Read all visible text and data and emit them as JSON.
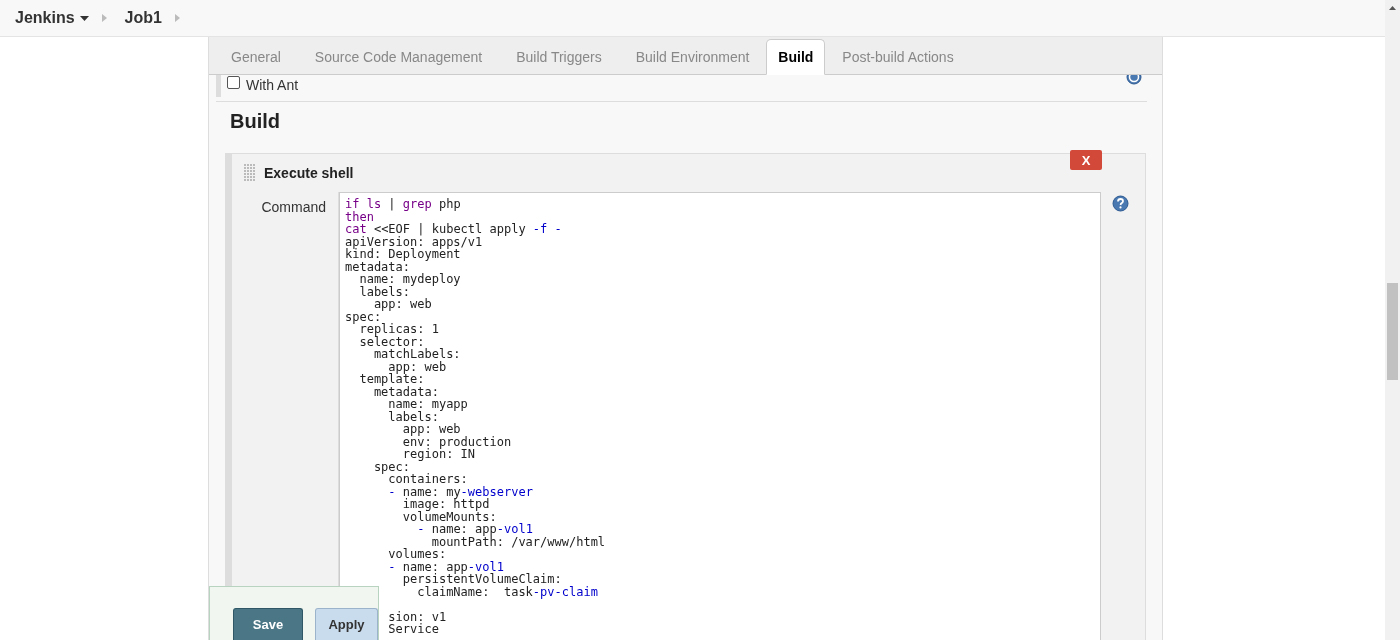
{
  "breadcrumb": [
    {
      "label": "Jenkins",
      "dropdown": true
    },
    {
      "label": "Job1",
      "dropdown": false
    }
  ],
  "tabs": [
    {
      "label": "General",
      "selected": false
    },
    {
      "label": "Source Code Management",
      "selected": false
    },
    {
      "label": "Build Triggers",
      "selected": false
    },
    {
      "label": "Build Environment",
      "selected": false
    },
    {
      "label": "Build",
      "selected": true
    },
    {
      "label": "Post-build Actions",
      "selected": false
    }
  ],
  "previous_option": {
    "label": "With Ant",
    "checked": false
  },
  "section_title": "Build",
  "build_step": {
    "title": "Execute shell",
    "delete_label": "X",
    "field_label": "Command",
    "lines": [
      {
        "tokens": [
          {
            "text": "if",
            "kind": "keyword"
          },
          {
            "text": " ls",
            "kind": "keyword"
          },
          {
            "text": " | ",
            "kind": "plain"
          },
          {
            "text": "grep",
            "kind": "keyword"
          },
          {
            "text": " php",
            "kind": "plain"
          }
        ]
      },
      {
        "tokens": [
          {
            "text": "then",
            "kind": "keyword"
          }
        ]
      },
      {
        "tokens": [
          {
            "text": "cat",
            "kind": "keyword"
          },
          {
            "text": " <<EOF | kubectl apply ",
            "kind": "plain"
          },
          {
            "text": "-f -",
            "kind": "operator"
          }
        ]
      },
      {
        "tokens": [
          {
            "text": "apiVersion: apps/v1",
            "kind": "plain"
          }
        ]
      },
      {
        "tokens": [
          {
            "text": "kind: Deployment",
            "kind": "plain"
          }
        ]
      },
      {
        "tokens": [
          {
            "text": "metadata:",
            "kind": "plain"
          }
        ]
      },
      {
        "tokens": [
          {
            "text": "  name: mydeploy",
            "kind": "plain"
          }
        ]
      },
      {
        "tokens": [
          {
            "text": "  labels:",
            "kind": "plain"
          }
        ]
      },
      {
        "tokens": [
          {
            "text": "    app: web",
            "kind": "plain"
          }
        ]
      },
      {
        "tokens": [
          {
            "text": "spec:",
            "kind": "plain"
          }
        ]
      },
      {
        "tokens": [
          {
            "text": "  replicas: 1",
            "kind": "plain"
          }
        ]
      },
      {
        "tokens": [
          {
            "text": "  selector:",
            "kind": "plain"
          }
        ]
      },
      {
        "tokens": [
          {
            "text": "    matchLabels:",
            "kind": "plain"
          }
        ]
      },
      {
        "tokens": [
          {
            "text": "      app: web",
            "kind": "plain"
          }
        ]
      },
      {
        "tokens": [
          {
            "text": "  template:",
            "kind": "plain"
          }
        ]
      },
      {
        "tokens": [
          {
            "text": "    metadata:",
            "kind": "plain"
          }
        ]
      },
      {
        "tokens": [
          {
            "text": "      name: myapp",
            "kind": "plain"
          }
        ]
      },
      {
        "tokens": [
          {
            "text": "      labels:",
            "kind": "plain"
          }
        ]
      },
      {
        "tokens": [
          {
            "text": "        app: web",
            "kind": "plain"
          }
        ]
      },
      {
        "tokens": [
          {
            "text": "        env: production",
            "kind": "plain"
          }
        ]
      },
      {
        "tokens": [
          {
            "text": "        region: IN",
            "kind": "plain"
          }
        ]
      },
      {
        "tokens": [
          {
            "text": "    spec:",
            "kind": "plain"
          }
        ]
      },
      {
        "tokens": [
          {
            "text": "      containers:",
            "kind": "plain"
          }
        ]
      },
      {
        "tokens": [
          {
            "text": "      -",
            "kind": "operator"
          },
          {
            "text": " name: my",
            "kind": "plain"
          },
          {
            "text": "-webserver",
            "kind": "operator"
          }
        ]
      },
      {
        "tokens": [
          {
            "text": "        image: httpd",
            "kind": "plain"
          }
        ]
      },
      {
        "tokens": [
          {
            "text": "        volumeMounts:",
            "kind": "plain"
          }
        ]
      },
      {
        "tokens": [
          {
            "text": "          -",
            "kind": "operator"
          },
          {
            "text": " name: app",
            "kind": "plain"
          },
          {
            "text": "-vol1",
            "kind": "operator"
          }
        ]
      },
      {
        "tokens": [
          {
            "text": "            mountPath: /var/www/html",
            "kind": "plain"
          }
        ]
      },
      {
        "tokens": [
          {
            "text": "      volumes:",
            "kind": "plain"
          }
        ]
      },
      {
        "tokens": [
          {
            "text": "      -",
            "kind": "operator"
          },
          {
            "text": " name: app",
            "kind": "plain"
          },
          {
            "text": "-vol1",
            "kind": "operator"
          }
        ]
      },
      {
        "tokens": [
          {
            "text": "        persistentVolumeClaim:",
            "kind": "plain"
          }
        ]
      },
      {
        "tokens": [
          {
            "text": "          claimName:  task",
            "kind": "plain"
          },
          {
            "text": "-pv-claim",
            "kind": "operator"
          }
        ]
      },
      {
        "blank_line_before": true,
        "tokens": [
          {
            "text": "      sion: v1",
            "kind": "plain"
          }
        ]
      },
      {
        "tokens": [
          {
            "text": "      Service",
            "kind": "plain"
          }
        ]
      }
    ]
  },
  "buttons": [
    {
      "label": "Save",
      "kind": "primary"
    },
    {
      "label": "Apply",
      "kind": "secondary"
    }
  ]
}
